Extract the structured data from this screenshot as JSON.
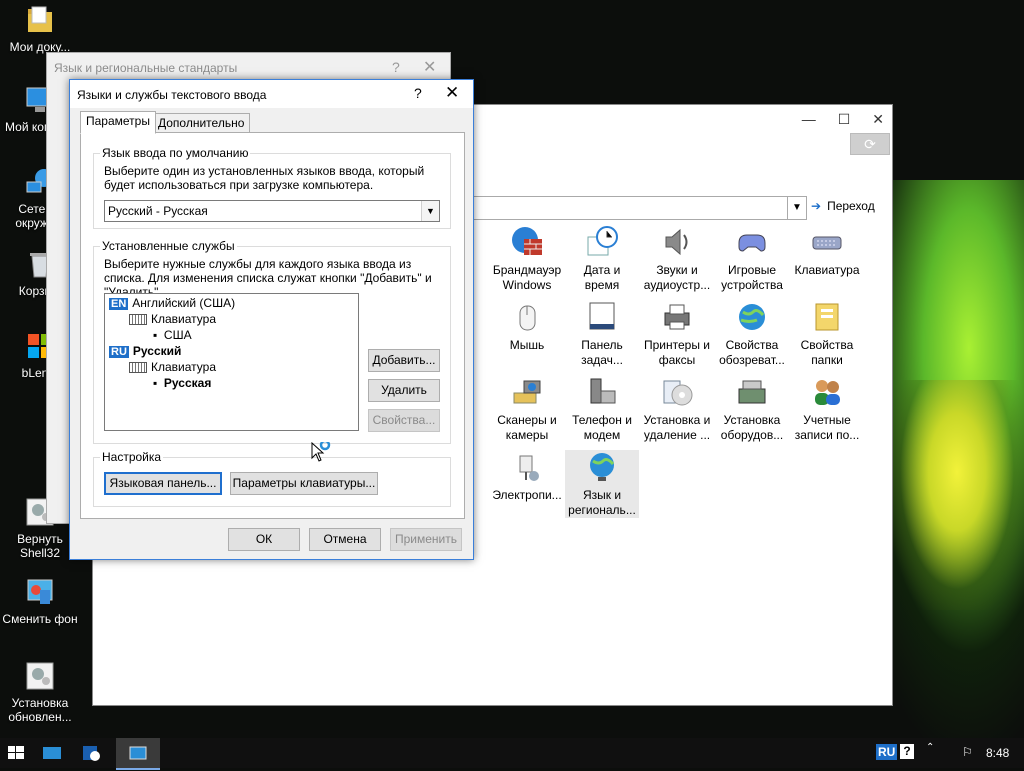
{
  "desktop": {
    "icons": [
      {
        "label": "Мои доку...",
        "icon": "folder-icon"
      },
      {
        "label": "Мой компь...",
        "icon": "computer-icon"
      },
      {
        "label": "Сетев... окруже...",
        "icon": "network-icon"
      },
      {
        "label": "Корзи...",
        "icon": "recycle-bin-icon"
      },
      {
        "label": "bLen...",
        "icon": "app-icon"
      },
      {
        "label": "Вернуть Shell32",
        "icon": "settings-icon"
      },
      {
        "label": "Сменить фон",
        "icon": "wallpaper-icon"
      },
      {
        "label": "Установка обновлен...",
        "icon": "settings-icon"
      }
    ]
  },
  "control_panel": {
    "go_label": "Переход",
    "items": [
      {
        "label": "Брандмауэр Windows",
        "icon": "firewall-icon"
      },
      {
        "label": "Дата и время",
        "icon": "clock-icon"
      },
      {
        "label": "Звуки и аудиоустр...",
        "icon": "speaker-icon"
      },
      {
        "label": "Игровые устройства",
        "icon": "gamepad-icon"
      },
      {
        "label": "Клавиатура",
        "icon": "keyboard-icon"
      },
      {
        "label": "Мышь",
        "icon": "mouse-icon"
      },
      {
        "label": "Панель задач...",
        "icon": "taskbar-icon"
      },
      {
        "label": "Принтеры и факсы",
        "icon": "printer-icon"
      },
      {
        "label": "Свойства обозреват...",
        "icon": "globe-icon"
      },
      {
        "label": "Свойства папки",
        "icon": "folder-options-icon"
      },
      {
        "label": "Сканеры и камеры",
        "icon": "scanner-icon"
      },
      {
        "label": "Телефон и модем",
        "icon": "phone-icon"
      },
      {
        "label": "Установка и удаление ...",
        "icon": "install-icon"
      },
      {
        "label": "Установка оборудов...",
        "icon": "hardware-icon"
      },
      {
        "label": "Учетные записи по...",
        "icon": "users-icon"
      },
      {
        "label": "Электропи...",
        "icon": "power-icon"
      },
      {
        "label": "Язык и региональ...",
        "icon": "globe-icon"
      }
    ]
  },
  "back_dialog": {
    "title": "Язык и региональные стандарты",
    "help": "?",
    "close": "✕"
  },
  "dialog": {
    "title": "Языки и службы текстового ввода",
    "help": "?",
    "close": "✕",
    "tabs": [
      "Параметры",
      "Дополнительно"
    ],
    "default_lang": {
      "group": "Язык ввода по умолчанию",
      "desc": "Выберите один из установленных языков ввода, который будет использоваться при загрузке компьютера.",
      "selected": "Русский - Русская"
    },
    "services": {
      "group": "Установленные службы",
      "desc": "Выберите нужные службы для каждого языка ввода из списка. Для изменения списка служат кнопки \"Добавить\" и \"Удалить\".",
      "tree": {
        "en_badge": "EN",
        "en_lang": "Английский (США)",
        "en_kb": "Клавиатура",
        "en_layout": "США",
        "ru_badge": "RU",
        "ru_lang": "Русский",
        "ru_kb": "Клавиатура",
        "ru_layout": "Русская"
      },
      "add": "Добавить...",
      "remove": "Удалить",
      "props": "Свойства..."
    },
    "settings": {
      "group": "Настройка",
      "lang_bar": "Языковая панель...",
      "key_settings": "Параметры клавиатуры..."
    },
    "ok": "ОК",
    "cancel": "Отмена",
    "apply": "Применить"
  },
  "taskbar": {
    "lang": "RU",
    "time": "8:48"
  }
}
